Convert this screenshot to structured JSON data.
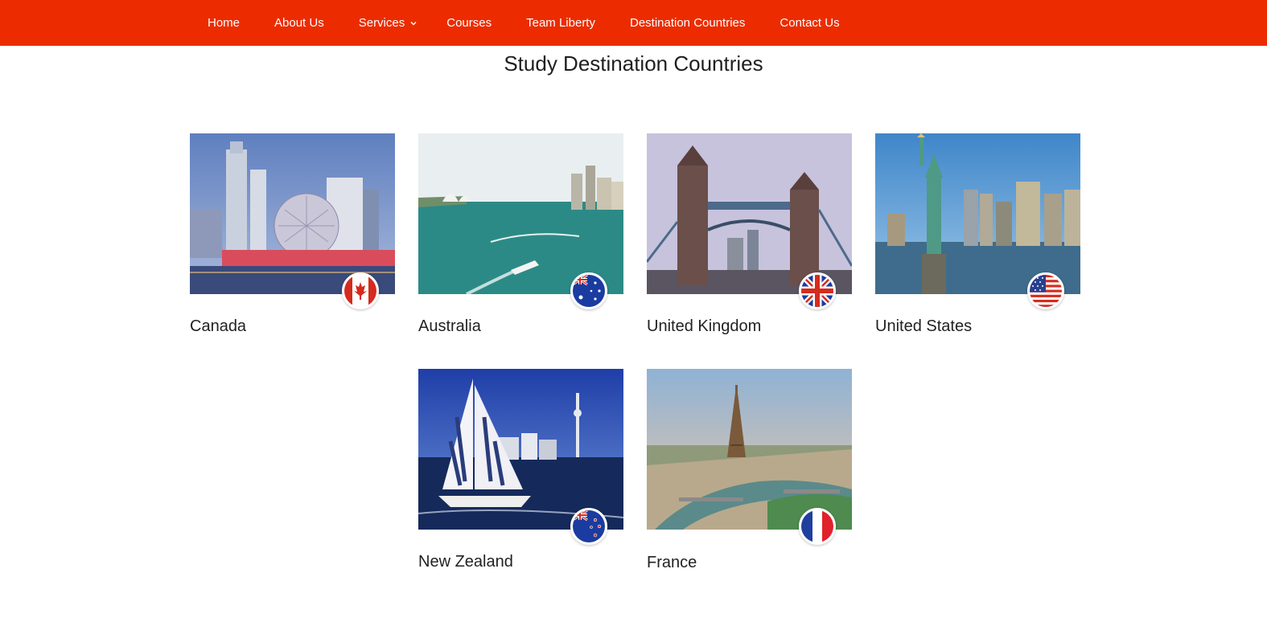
{
  "nav": {
    "items": [
      "Home",
      "About Us",
      "Services",
      "Courses",
      "Team Liberty",
      "Destination Countries",
      "Contact Us"
    ]
  },
  "page": {
    "title": "Study Destination Countries"
  },
  "countries": [
    {
      "name": "Canada",
      "flag_icon": "canada-flag-icon"
    },
    {
      "name": "Australia",
      "flag_icon": "australia-flag-icon"
    },
    {
      "name": "United Kingdom",
      "flag_icon": "uk-flag-icon"
    },
    {
      "name": "United States",
      "flag_icon": "usa-flag-icon"
    },
    {
      "name": "New Zealand",
      "flag_icon": "new-zealand-flag-icon"
    },
    {
      "name": "France",
      "flag_icon": "france-flag-icon"
    }
  ],
  "colors": {
    "nav_bg": "#ec2c00",
    "nav_text": "#ffffff",
    "title_text": "#1f1f1f"
  }
}
